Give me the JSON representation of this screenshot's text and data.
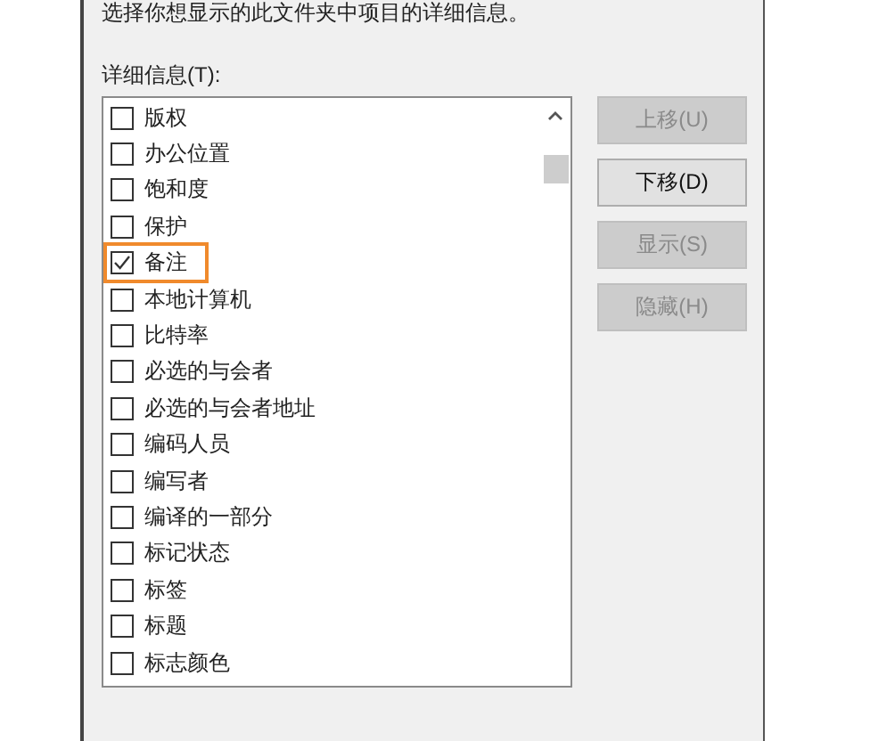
{
  "description": "选择你想显示的此文件夹中项目的详细信息。",
  "details_label": "详细信息(T):",
  "items": [
    {
      "label": "版权",
      "checked": false,
      "highlighted": false
    },
    {
      "label": "办公位置",
      "checked": false,
      "highlighted": false
    },
    {
      "label": "饱和度",
      "checked": false,
      "highlighted": false
    },
    {
      "label": "保护",
      "checked": false,
      "highlighted": false
    },
    {
      "label": "备注",
      "checked": true,
      "highlighted": true
    },
    {
      "label": "本地计算机",
      "checked": false,
      "highlighted": false
    },
    {
      "label": "比特率",
      "checked": false,
      "highlighted": false
    },
    {
      "label": "必选的与会者",
      "checked": false,
      "highlighted": false
    },
    {
      "label": "必选的与会者地址",
      "checked": false,
      "highlighted": false
    },
    {
      "label": "编码人员",
      "checked": false,
      "highlighted": false
    },
    {
      "label": "编写者",
      "checked": false,
      "highlighted": false
    },
    {
      "label": "编译的一部分",
      "checked": false,
      "highlighted": false
    },
    {
      "label": "标记状态",
      "checked": false,
      "highlighted": false
    },
    {
      "label": "标签",
      "checked": false,
      "highlighted": false
    },
    {
      "label": "标题",
      "checked": false,
      "highlighted": false
    },
    {
      "label": "标志颜色",
      "checked": false,
      "highlighted": false
    }
  ],
  "buttons": [
    {
      "label": "上移(U)",
      "disabled": true
    },
    {
      "label": "下移(D)",
      "disabled": false
    },
    {
      "label": "显示(S)",
      "disabled": true
    },
    {
      "label": "隐藏(H)",
      "disabled": true
    }
  ]
}
